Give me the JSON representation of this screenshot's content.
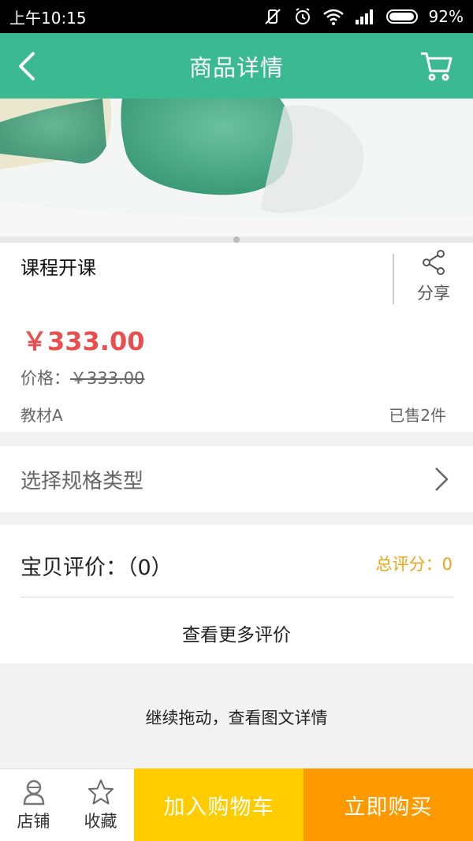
{
  "status_bar": {
    "time": "上午10:15",
    "battery": "92%"
  },
  "header": {
    "title": "商品详情"
  },
  "product": {
    "title": "课程开课",
    "share_label": "分享",
    "price": "￥333.00",
    "original_price_label": "价格：",
    "original_price": "￥333.00",
    "material": "教材A",
    "sold": "已售2件"
  },
  "spec": {
    "label": "选择规格类型"
  },
  "reviews": {
    "title": "宝贝评价：（0）",
    "score": "总评分：0",
    "more": "查看更多评价"
  },
  "drag_hint": "继续拖动，查看图文详情",
  "bottom_bar": {
    "shop_label": "店铺",
    "favorite_label": "收藏",
    "add_cart_label": "加入购物车",
    "buy_label": "立即购买"
  },
  "colors": {
    "accent": "#3bb990",
    "price": "#e94f4f",
    "score": "#f0a317",
    "cart_button": "#ffcc00",
    "buy_button": "#ff9900"
  }
}
